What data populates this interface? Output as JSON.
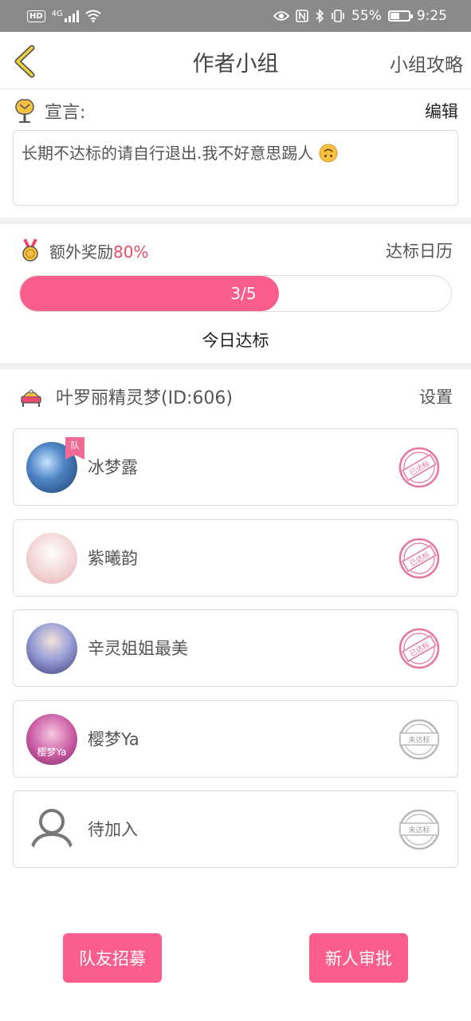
{
  "status_bar": {
    "left_badge": "HD",
    "network": "4G",
    "battery_text": "55%",
    "time": "9:25",
    "battery_level": 0.55
  },
  "header": {
    "title": "作者小组",
    "right_link": "小组攻略",
    "back_icon": "chevron-left-icon"
  },
  "declaration": {
    "label": "宣言:",
    "edit_label": "编辑",
    "text": "长期不达标的请自行退出.我不好意思踢人",
    "icon": "mailbox-icon"
  },
  "reward": {
    "label": "额外奖励",
    "percent": "80%",
    "calendar_link": "达标日历",
    "progress_text": "3/5",
    "progress_value": 0.6,
    "today_label": "今日达标",
    "icon": "medal-icon"
  },
  "group": {
    "name": "叶罗丽精灵梦(ID:606)",
    "settings_label": "设置",
    "icon": "throne-icon"
  },
  "members": [
    {
      "name": "冰梦露",
      "status": "已达标",
      "achieved": true,
      "leader_tag": "队",
      "avatar_color": "#3b6fb0"
    },
    {
      "name": "紫曦韵",
      "status": "已达标",
      "achieved": true,
      "avatar_color": "#f3d4d4"
    },
    {
      "name": "辛灵姐姐最美",
      "status": "已达标",
      "achieved": true,
      "avatar_color": "#8a88c8"
    },
    {
      "name": "樱梦Ya",
      "status": "未达标",
      "achieved": false,
      "avatar_text": "樱梦Ya",
      "avatar_color": "#c95aa3"
    },
    {
      "name": "待加入",
      "status": "未达标",
      "achieved": false,
      "avatar_color": "#ffffff"
    }
  ],
  "buttons": {
    "recruit": "队友招募",
    "approve": "新人审批"
  },
  "colors": {
    "accent": "#fb5e8c",
    "stamp_achieved": "#e9759a",
    "stamp_not": "#b8b8b8"
  }
}
